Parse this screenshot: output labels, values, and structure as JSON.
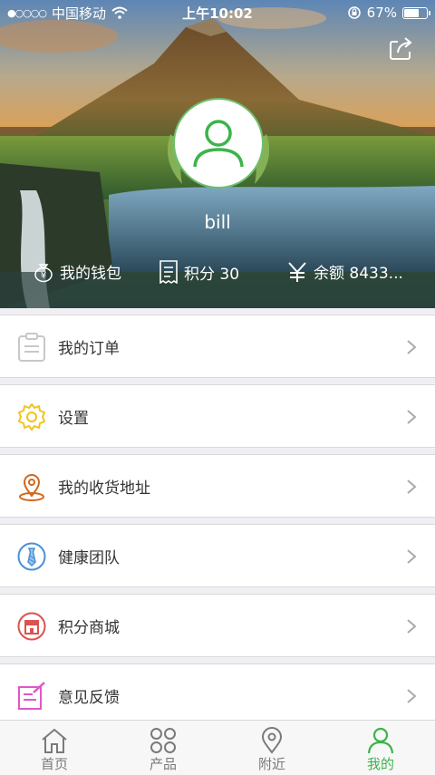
{
  "status_bar": {
    "carrier": "中国移动",
    "time": "上午10:02",
    "battery": "67%",
    "battery_level": 0.67
  },
  "profile": {
    "username": "bill"
  },
  "stats": {
    "wallet_label": "我的钱包",
    "points_label": "积分 30",
    "balance_label": "余额 8433..."
  },
  "menu": {
    "items": [
      {
        "label": "我的订单",
        "icon": "clipboard-icon",
        "color": "#c8c8c8"
      },
      {
        "label": "设置",
        "icon": "gear-icon",
        "color": "#f0c419"
      },
      {
        "label": "我的收货地址",
        "icon": "location-pin-icon",
        "color": "#d2691e"
      },
      {
        "label": "健康团队",
        "icon": "tie-icon",
        "color": "#4a90d9"
      },
      {
        "label": "积分商城",
        "icon": "store-icon",
        "color": "#d9534f"
      },
      {
        "label": "意见反馈",
        "icon": "feedback-edit-icon",
        "color": "#e056c8"
      }
    ]
  },
  "tabbar": {
    "tabs": [
      {
        "label": "首页",
        "icon": "home-icon",
        "active": false
      },
      {
        "label": "产品",
        "icon": "grid-clover-icon",
        "active": false
      },
      {
        "label": "附近",
        "icon": "location-icon",
        "active": false
      },
      {
        "label": "我的",
        "icon": "person-icon",
        "active": true
      }
    ],
    "active_color": "#3cb44a"
  }
}
